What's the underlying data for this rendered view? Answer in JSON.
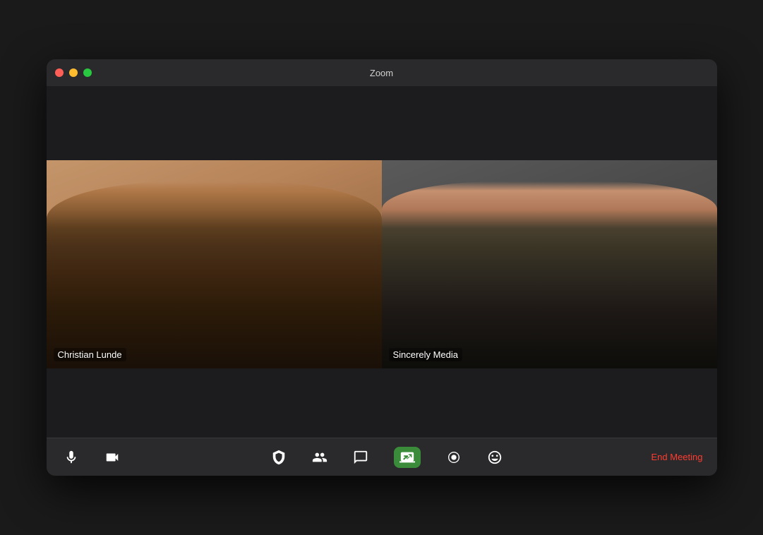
{
  "window": {
    "title": "Zoom"
  },
  "traffic_lights": {
    "close_label": "close",
    "minimize_label": "minimize",
    "maximize_label": "maximize"
  },
  "participants": [
    {
      "id": "participant-1",
      "name": "Christian Lunde",
      "active_speaker": true
    },
    {
      "id": "participant-2",
      "name": "Sincerely Media",
      "active_speaker": false
    }
  ],
  "toolbar": {
    "mute_label": "Mute",
    "video_label": "Stop Video",
    "security_label": "Security",
    "participants_label": "Participants",
    "chat_label": "Chat",
    "share_label": "Share Screen",
    "record_label": "Record",
    "reactions_label": "Reactions",
    "end_meeting_label": "End Meeting"
  }
}
